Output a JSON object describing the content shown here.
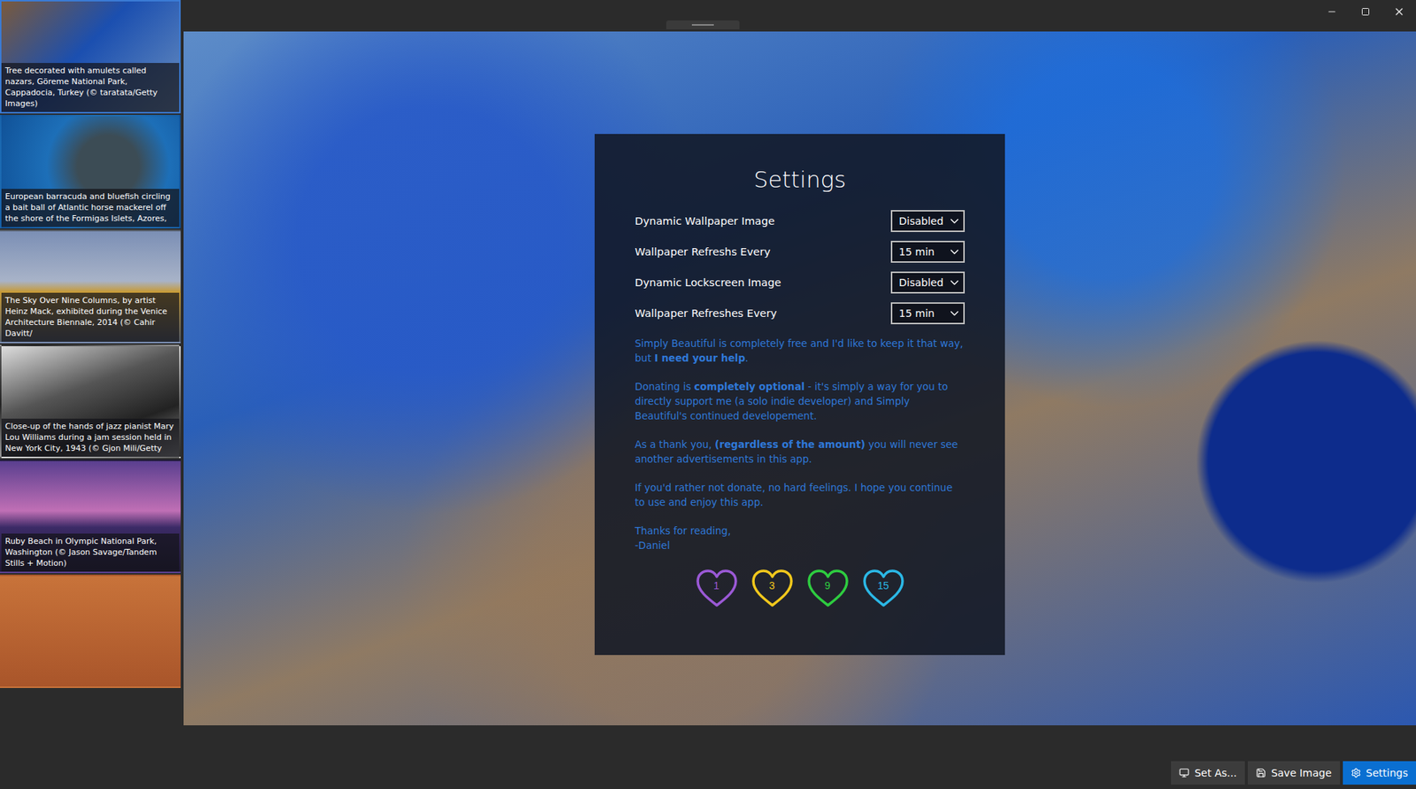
{
  "sidebar": {
    "items": [
      {
        "caption": "Tree decorated with amulets called nazars, Göreme National Park, Cappadocia, Turkey (© taratata/Getty Images)",
        "selected": true
      },
      {
        "caption": "European barracuda and bluefish circling a bait ball of Atlantic horse mackerel off the shore of the Formigas Islets, Azores,",
        "selected": false
      },
      {
        "caption": "The Sky Over Nine Columns, by artist Heinz Mack, exhibited during the Venice Architecture Biennale, 2014 (© Cahir Davitt/",
        "selected": false
      },
      {
        "caption": "Close-up of the hands of jazz pianist Mary Lou Williams during a jam session held in New York City, 1943 (© Gjon Mili/Getty",
        "selected": false
      },
      {
        "caption": "Ruby Beach in Olympic National Park, Washington (© Jason Savage/Tandem Stills + Motion)",
        "selected": false
      },
      {
        "caption": "",
        "selected": false
      }
    ]
  },
  "settings": {
    "title": "Settings",
    "rows": [
      {
        "label": "Dynamic Wallpaper Image",
        "value": "Disabled"
      },
      {
        "label": "Wallpaper Refreshs Every",
        "value": "15 min"
      },
      {
        "label": "Dynamic Lockscreen Image",
        "value": "Disabled"
      },
      {
        "label": "Wallpaper Refreshes Every",
        "value": "15 min"
      }
    ],
    "message": [
      [
        {
          "text": "Simply Beautiful is completely free and I'd like to keep it that way, but ",
          "bold": false
        },
        {
          "text": "I need your help",
          "bold": true
        },
        {
          "text": ".",
          "bold": false
        }
      ],
      [
        {
          "text": "Donating is ",
          "bold": false
        },
        {
          "text": "completely optional",
          "bold": true
        },
        {
          "text": " - it's simply a way for you to directly support me (a solo indie developer) and Simply Beautiful's continued developement.",
          "bold": false
        }
      ],
      [
        {
          "text": "As a thank you, ",
          "bold": false
        },
        {
          "text": "(regardless of the amount)",
          "bold": true
        },
        {
          "text": " you will never see another advertisements in this app.",
          "bold": false
        }
      ],
      [
        {
          "text": "If you'd rather not donate, no hard feelings. I hope you continue to use and enjoy this app.",
          "bold": false
        }
      ]
    ],
    "signature": [
      "Thanks for reading,",
      "-Daniel"
    ],
    "donations": [
      {
        "amount": "1",
        "color": "#9b59d6"
      },
      {
        "amount": "3",
        "color": "#f2c81c"
      },
      {
        "amount": "9",
        "color": "#2ecc40"
      },
      {
        "amount": "15",
        "color": "#2bb8e6"
      }
    ]
  },
  "toolbar": {
    "buttons": [
      {
        "label": "Set As...",
        "selected": false
      },
      {
        "label": "Save Image",
        "selected": false
      },
      {
        "label": "Settings",
        "selected": true
      }
    ]
  }
}
